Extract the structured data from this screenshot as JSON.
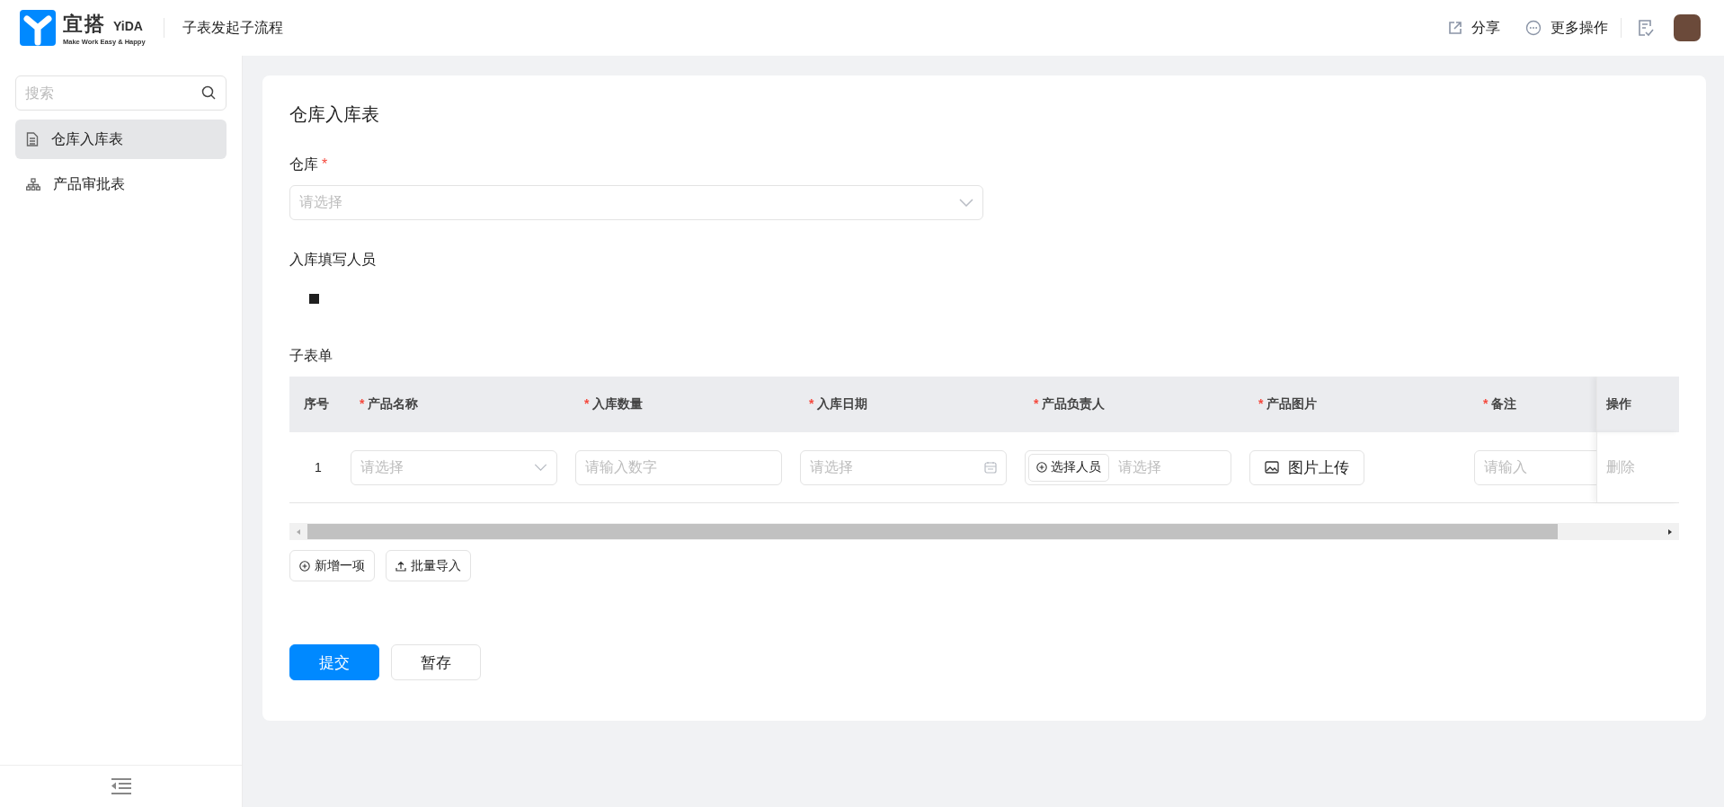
{
  "header": {
    "logo": {
      "name": "宜搭",
      "brand": "YiDA",
      "slogan": "Make Work Easy & Happy"
    },
    "title": "子表发起子流程",
    "actions": [
      {
        "kind": "share",
        "label": "分享"
      },
      {
        "kind": "more",
        "label": "更多操作"
      }
    ]
  },
  "sidebar": {
    "search": {
      "placeholder": "搜索"
    },
    "items": [
      {
        "kind": "form",
        "label": "仓库入库表",
        "selected": true
      },
      {
        "kind": "process",
        "label": "产品审批表",
        "selected": false
      }
    ]
  },
  "form": {
    "title": "仓库入库表",
    "required_mark": "*",
    "fields": [
      {
        "kind": "select",
        "label": "仓库",
        "required": true,
        "placeholder": "请选择"
      },
      {
        "kind": "user",
        "label": "入库填写人员",
        "required": false
      }
    ],
    "subform": {
      "label": "子表单",
      "columns": [
        {
          "label": "序号",
          "required": false
        },
        {
          "label": "产品名称",
          "required": true
        },
        {
          "label": "入库数量",
          "required": true
        },
        {
          "label": "入库日期",
          "required": true
        },
        {
          "label": "产品负责人",
          "required": true
        },
        {
          "label": "产品图片",
          "required": true
        },
        {
          "label": "备注",
          "required": true
        },
        {
          "label": "操作",
          "required": false
        }
      ],
      "rows": [
        {
          "cells": [
            {
              "kind": "index",
              "text": "1"
            },
            {
              "kind": "select",
              "placeholder": "请选择"
            },
            {
              "kind": "input",
              "placeholder": "请输入数字"
            },
            {
              "kind": "date",
              "placeholder": "请选择"
            },
            {
              "kind": "person",
              "button": "选择人员",
              "placeholder": "请选择"
            },
            {
              "kind": "upload",
              "button": "图片上传"
            },
            {
              "kind": "input",
              "placeholder": "请输入"
            },
            {
              "kind": "action",
              "text": "删除"
            }
          ]
        }
      ],
      "buttons": [
        {
          "kind": "add",
          "label": "新增一项"
        },
        {
          "kind": "import",
          "label": "批量导入"
        }
      ]
    },
    "buttons": [
      {
        "kind": "primary",
        "label": "提交"
      },
      {
        "kind": "default",
        "label": "暂存"
      }
    ]
  }
}
